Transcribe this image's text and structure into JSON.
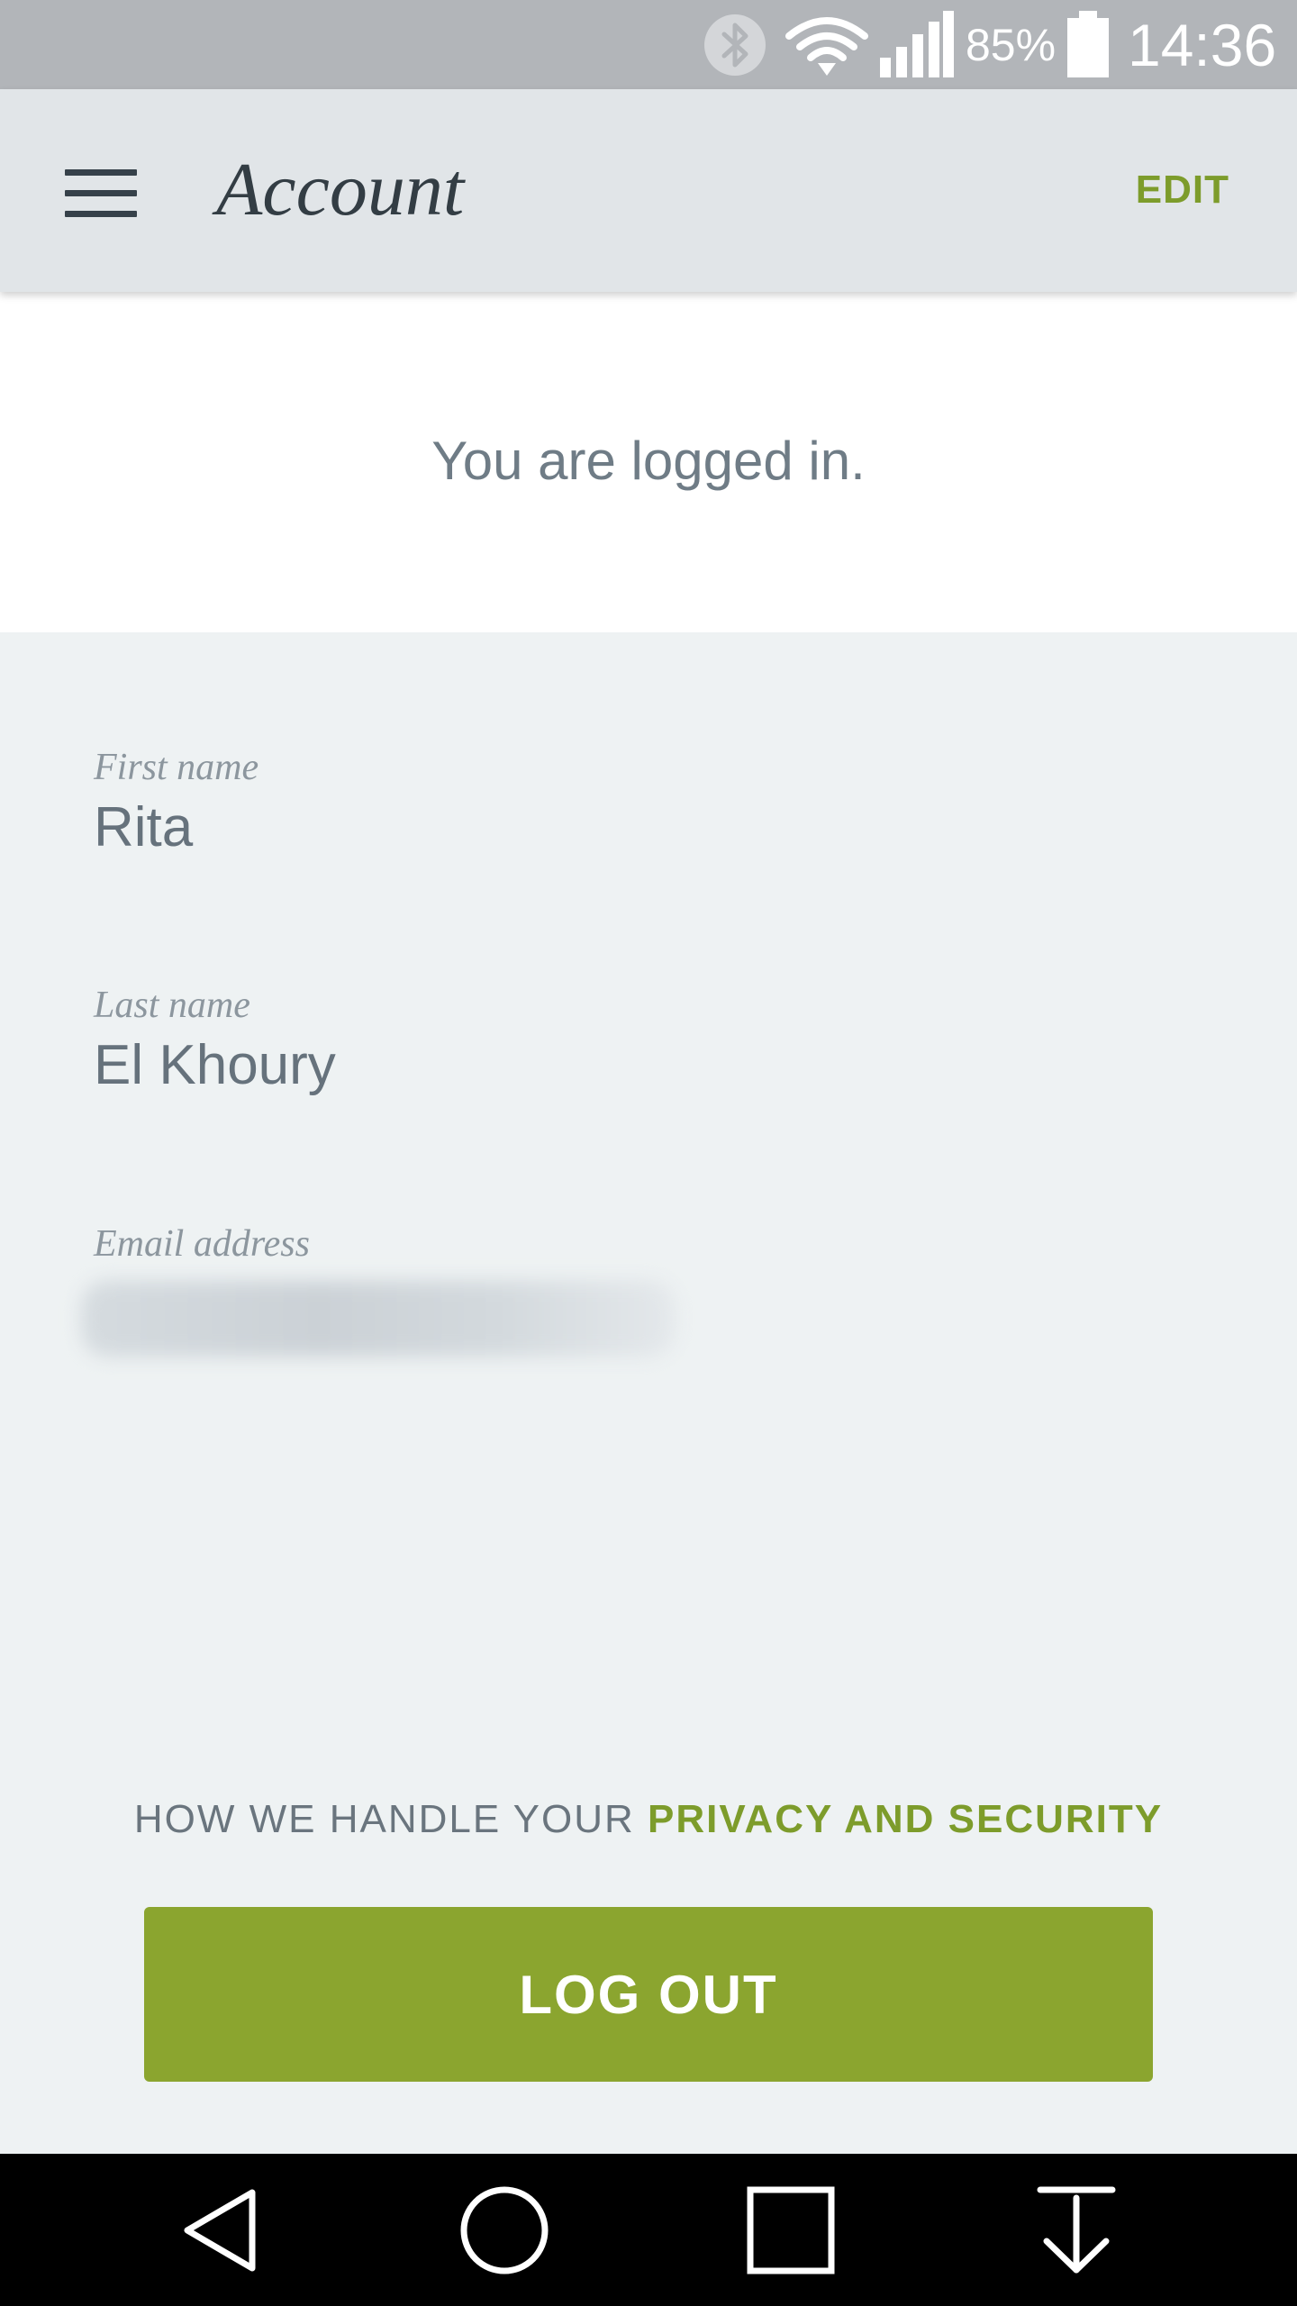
{
  "status_bar": {
    "battery_percent": "85%",
    "time": "14:36",
    "icons": [
      "bluetooth-icon",
      "wifi-icon",
      "signal-icon",
      "battery-icon"
    ]
  },
  "app_bar": {
    "menu_icon": "hamburger-menu-icon",
    "title": "Account",
    "edit_label": "EDIT"
  },
  "banner": {
    "text": "You are logged in."
  },
  "fields": {
    "first_name": {
      "label": "First name",
      "value": "Rita"
    },
    "last_name": {
      "label": "Last name",
      "value": "El Khoury"
    },
    "email": {
      "label": "Email address"
    }
  },
  "privacy": {
    "prefix": "HOW WE HANDLE YOUR ",
    "link": "PRIVACY AND SECURITY"
  },
  "logout": {
    "label": "LOG OUT"
  },
  "nav_bar": {
    "icons": [
      "back-icon",
      "home-icon",
      "recents-icon",
      "notification-down-icon"
    ]
  },
  "colors": {
    "accent": "#8ba52f",
    "accent_text": "#7d9c2b",
    "app_bar": "#e1e5e8",
    "status_bar": "#b2b5b9",
    "background": "#eef2f3"
  }
}
